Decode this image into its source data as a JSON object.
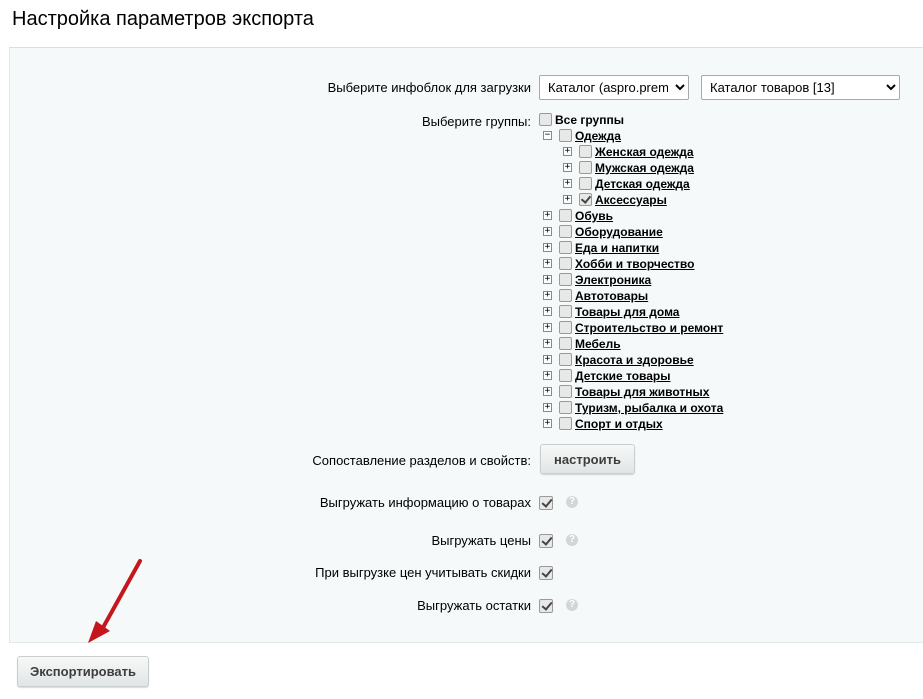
{
  "page": {
    "title": "Настройка параметров экспорта"
  },
  "infoblock": {
    "label": "Выберите инфоблок для загрузки",
    "catalog_select": "Каталог (aspro.premier)",
    "iblock_select": "Каталог товаров [13]"
  },
  "groups": {
    "label": "Выберите группы:",
    "all_label": "Все группы",
    "items": [
      {
        "label": "Одежда",
        "expanded": true,
        "checked": false
      },
      {
        "label": "Женская одежда",
        "checked": false
      },
      {
        "label": "Мужская одежда",
        "checked": false
      },
      {
        "label": "Детская одежда",
        "checked": false
      },
      {
        "label": "Аксессуары",
        "checked": true
      },
      {
        "label": "Обувь",
        "checked": false
      },
      {
        "label": "Оборудование",
        "checked": false
      },
      {
        "label": "Еда и напитки",
        "checked": false
      },
      {
        "label": "Хобби и творчество",
        "checked": false
      },
      {
        "label": "Электроника",
        "checked": false
      },
      {
        "label": "Автотовары",
        "checked": false
      },
      {
        "label": "Товары для дома",
        "checked": false
      },
      {
        "label": "Строительство и ремонт",
        "checked": false
      },
      {
        "label": "Мебель",
        "checked": false
      },
      {
        "label": "Красота и здоровье",
        "checked": false
      },
      {
        "label": "Детские товары",
        "checked": false
      },
      {
        "label": "Товары для животных",
        "checked": false
      },
      {
        "label": "Туризм, рыбалка и охота",
        "checked": false
      },
      {
        "label": "Спорт и отдых",
        "checked": false
      }
    ]
  },
  "mapping": {
    "label": "Сопоставление разделов и свойств:",
    "button": "настроить"
  },
  "options": [
    {
      "label": "Выгружать информацию о товарах",
      "checked": true,
      "help": true
    },
    {
      "label": "Выгружать цены",
      "checked": true,
      "help": true
    },
    {
      "label": "При выгрузке цен учитывать скидки",
      "checked": true,
      "help": false
    },
    {
      "label": "Выгружать остатки",
      "checked": true,
      "help": true
    }
  ],
  "help_glyph": "?",
  "export_button": "Экспортировать",
  "colors": {
    "arrow": "#c4161c",
    "panel_bg": "#f5f9f9"
  },
  "icons": {
    "arrow": "red-arrow-annotation"
  }
}
